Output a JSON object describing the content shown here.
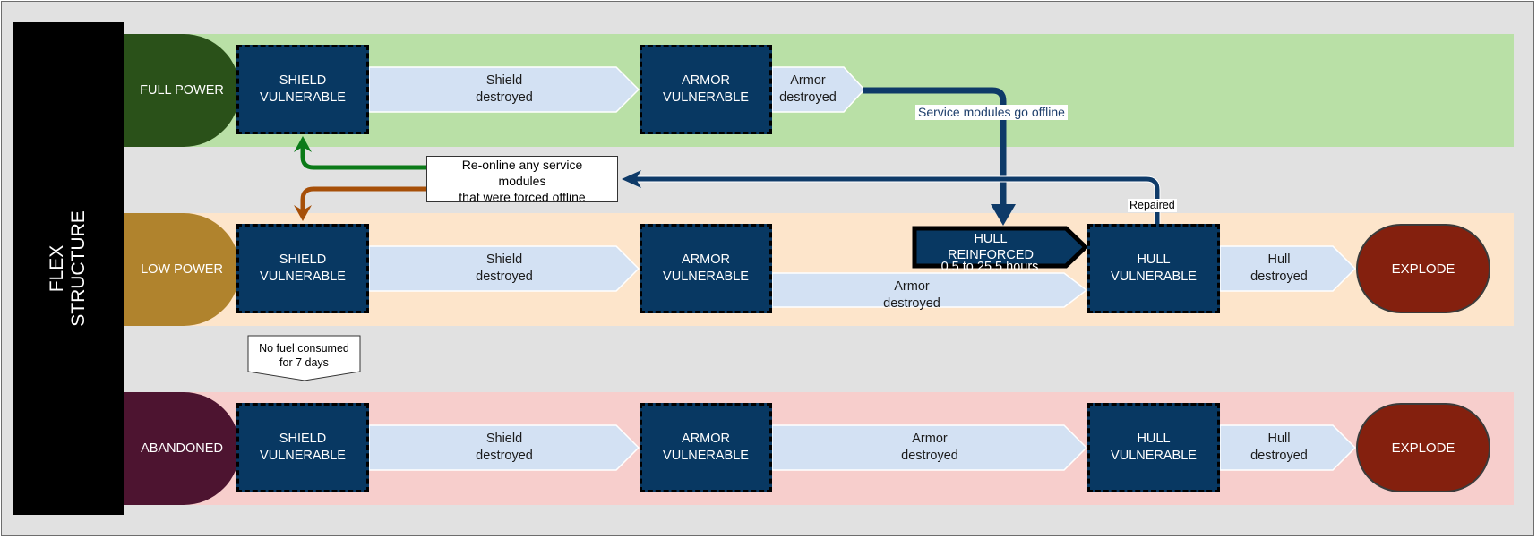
{
  "title": "FLEX\nSTRUCTURE",
  "title_lines": [
    "FLEX",
    "STRUCTURE"
  ],
  "colors": {
    "background": "#e1e1e1",
    "full_power_lane": "#b9e0a6",
    "low_power_lane": "#fde5cb",
    "abandoned_lane": "#f7cecc",
    "full_power_state": "#2a5119",
    "low_power_state": "#b0832d",
    "abandoned_state": "#4d1430",
    "vulnerable_node": "#083862",
    "transition_arrow": "#d3e1f3",
    "explode": "#84200e",
    "connector_blue": "#0e3a68",
    "connector_green": "#0b7a18",
    "connector_orange": "#a64f08"
  },
  "lanes": [
    {
      "state": "FULL POWER",
      "nodes": [
        "SHIELD\nVULNERABLE",
        "ARMOR\nVULNERABLE"
      ],
      "transitions": [
        "Shield\ndestroyed",
        "Armor\ndestroyed"
      ]
    },
    {
      "state": "LOW POWER",
      "nodes": [
        "SHIELD\nVULNERABLE",
        "ARMOR\nVULNERABLE",
        "HULL\nVULNERABLE"
      ],
      "transitions": [
        "Shield\ndestroyed",
        "Armor\ndestroyed",
        "Hull\ndestroyed"
      ],
      "reinforced": {
        "label": "HULL\nREINFORCED",
        "duration": "0.5 to 25.5 hours"
      },
      "end": "EXPLODE"
    },
    {
      "state": "ABANDONED",
      "nodes": [
        "SHIELD\nVULNERABLE",
        "ARMOR\nVULNERABLE",
        "HULL\nVULNERABLE"
      ],
      "transitions": [
        "Shield\ndestroyed",
        "Armor\ndestroyed",
        "Hull\ndestroyed"
      ],
      "end": "EXPLODE"
    }
  ],
  "connectors": {
    "service_offline": "Service modules go offline",
    "repaired": "Repaired",
    "reonline_callout": "Re-online any service\nmodules\nthat were forced offline",
    "no_fuel_callout": "No fuel consumed\nfor 7 days"
  }
}
